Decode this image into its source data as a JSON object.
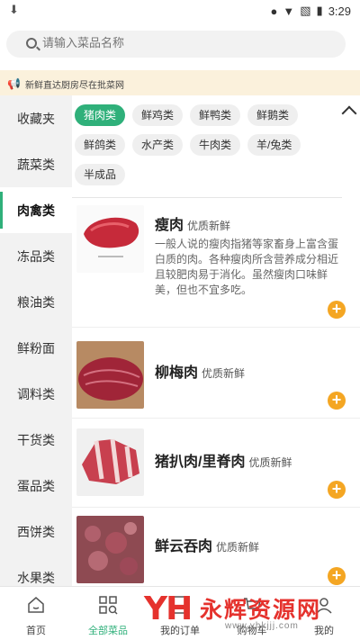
{
  "status_bar": {
    "time": "3:29"
  },
  "search": {
    "placeholder": "请输入菜品名称"
  },
  "notice": {
    "text": "新鲜直达厨房尽在批菜网"
  },
  "sidebar": {
    "items": [
      {
        "label": "收藏夹"
      },
      {
        "label": "蔬菜类"
      },
      {
        "label": "肉禽类"
      },
      {
        "label": "冻品类"
      },
      {
        "label": "粮油类"
      },
      {
        "label": "鲜粉面"
      },
      {
        "label": "调料类"
      },
      {
        "label": "干货类"
      },
      {
        "label": "蛋品类"
      },
      {
        "label": "西饼类"
      },
      {
        "label": "水果类"
      }
    ],
    "active": "肉禽类"
  },
  "tags": {
    "items": [
      {
        "label": "猪肉类"
      },
      {
        "label": "鲜鸡类"
      },
      {
        "label": "鲜鸭类"
      },
      {
        "label": "鲜鹅类"
      },
      {
        "label": "鲜鸽类"
      },
      {
        "label": "水产类"
      },
      {
        "label": "牛肉类"
      },
      {
        "label": "羊/兔类"
      },
      {
        "label": "半成品"
      }
    ],
    "active": "猪肉类"
  },
  "products": [
    {
      "name": "瘦肉",
      "tag": "优质新鲜",
      "desc": "一般人说的瘦肉指猪等家畜身上富含蛋白质的肉。各种瘦肉所含营养成分相近且较肥肉易于消化。虽然瘦肉口味鲜美，但也不宜多吃。"
    },
    {
      "name": "柳梅肉",
      "tag": "优质新鲜",
      "desc": ""
    },
    {
      "name": "猪扒肉/里脊肉",
      "tag": "优质新鲜",
      "desc": ""
    },
    {
      "name": "鲜云吞肉",
      "tag": "优质新鲜",
      "desc": ""
    }
  ],
  "bottom_nav": {
    "items": [
      {
        "label": "首页",
        "icon": "home-icon"
      },
      {
        "label": "全部菜品",
        "icon": "grid-search-icon"
      },
      {
        "label": "我的订单",
        "icon": "order-icon"
      },
      {
        "label": "购物车",
        "icon": "cart-icon"
      },
      {
        "label": "我的",
        "icon": "user-icon"
      }
    ],
    "active": "全部菜品"
  },
  "watermark": {
    "logo": "YH",
    "text": "永辉资源网",
    "url": "www.yhkjjj.com"
  },
  "colors": {
    "accent": "#2fb07a",
    "add_button": "#f4a623",
    "notice_bg": "#fbf1dc",
    "watermark": "#e5322d"
  }
}
